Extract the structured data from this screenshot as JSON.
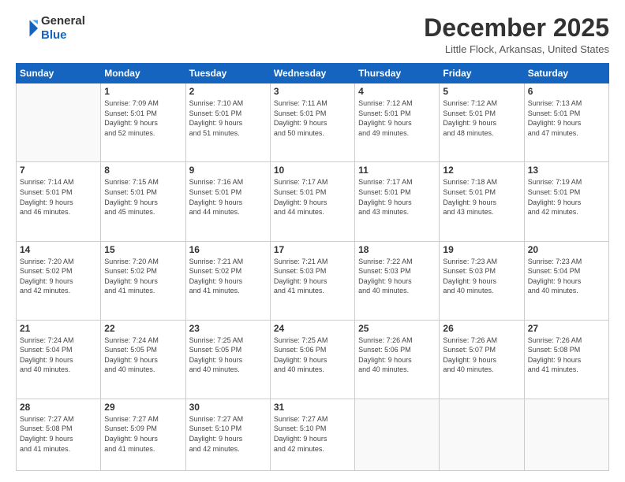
{
  "logo": {
    "line1": "General",
    "line2": "Blue"
  },
  "title": "December 2025",
  "location": "Little Flock, Arkansas, United States",
  "days_of_week": [
    "Sunday",
    "Monday",
    "Tuesday",
    "Wednesday",
    "Thursday",
    "Friday",
    "Saturday"
  ],
  "weeks": [
    [
      {
        "day": "",
        "info": ""
      },
      {
        "day": "1",
        "info": "Sunrise: 7:09 AM\nSunset: 5:01 PM\nDaylight: 9 hours\nand 52 minutes."
      },
      {
        "day": "2",
        "info": "Sunrise: 7:10 AM\nSunset: 5:01 PM\nDaylight: 9 hours\nand 51 minutes."
      },
      {
        "day": "3",
        "info": "Sunrise: 7:11 AM\nSunset: 5:01 PM\nDaylight: 9 hours\nand 50 minutes."
      },
      {
        "day": "4",
        "info": "Sunrise: 7:12 AM\nSunset: 5:01 PM\nDaylight: 9 hours\nand 49 minutes."
      },
      {
        "day": "5",
        "info": "Sunrise: 7:12 AM\nSunset: 5:01 PM\nDaylight: 9 hours\nand 48 minutes."
      },
      {
        "day": "6",
        "info": "Sunrise: 7:13 AM\nSunset: 5:01 PM\nDaylight: 9 hours\nand 47 minutes."
      }
    ],
    [
      {
        "day": "7",
        "info": "Sunrise: 7:14 AM\nSunset: 5:01 PM\nDaylight: 9 hours\nand 46 minutes."
      },
      {
        "day": "8",
        "info": "Sunrise: 7:15 AM\nSunset: 5:01 PM\nDaylight: 9 hours\nand 45 minutes."
      },
      {
        "day": "9",
        "info": "Sunrise: 7:16 AM\nSunset: 5:01 PM\nDaylight: 9 hours\nand 44 minutes."
      },
      {
        "day": "10",
        "info": "Sunrise: 7:17 AM\nSunset: 5:01 PM\nDaylight: 9 hours\nand 44 minutes."
      },
      {
        "day": "11",
        "info": "Sunrise: 7:17 AM\nSunset: 5:01 PM\nDaylight: 9 hours\nand 43 minutes."
      },
      {
        "day": "12",
        "info": "Sunrise: 7:18 AM\nSunset: 5:01 PM\nDaylight: 9 hours\nand 43 minutes."
      },
      {
        "day": "13",
        "info": "Sunrise: 7:19 AM\nSunset: 5:01 PM\nDaylight: 9 hours\nand 42 minutes."
      }
    ],
    [
      {
        "day": "14",
        "info": "Sunrise: 7:20 AM\nSunset: 5:02 PM\nDaylight: 9 hours\nand 42 minutes."
      },
      {
        "day": "15",
        "info": "Sunrise: 7:20 AM\nSunset: 5:02 PM\nDaylight: 9 hours\nand 41 minutes."
      },
      {
        "day": "16",
        "info": "Sunrise: 7:21 AM\nSunset: 5:02 PM\nDaylight: 9 hours\nand 41 minutes."
      },
      {
        "day": "17",
        "info": "Sunrise: 7:21 AM\nSunset: 5:03 PM\nDaylight: 9 hours\nand 41 minutes."
      },
      {
        "day": "18",
        "info": "Sunrise: 7:22 AM\nSunset: 5:03 PM\nDaylight: 9 hours\nand 40 minutes."
      },
      {
        "day": "19",
        "info": "Sunrise: 7:23 AM\nSunset: 5:03 PM\nDaylight: 9 hours\nand 40 minutes."
      },
      {
        "day": "20",
        "info": "Sunrise: 7:23 AM\nSunset: 5:04 PM\nDaylight: 9 hours\nand 40 minutes."
      }
    ],
    [
      {
        "day": "21",
        "info": "Sunrise: 7:24 AM\nSunset: 5:04 PM\nDaylight: 9 hours\nand 40 minutes."
      },
      {
        "day": "22",
        "info": "Sunrise: 7:24 AM\nSunset: 5:05 PM\nDaylight: 9 hours\nand 40 minutes."
      },
      {
        "day": "23",
        "info": "Sunrise: 7:25 AM\nSunset: 5:05 PM\nDaylight: 9 hours\nand 40 minutes."
      },
      {
        "day": "24",
        "info": "Sunrise: 7:25 AM\nSunset: 5:06 PM\nDaylight: 9 hours\nand 40 minutes."
      },
      {
        "day": "25",
        "info": "Sunrise: 7:26 AM\nSunset: 5:06 PM\nDaylight: 9 hours\nand 40 minutes."
      },
      {
        "day": "26",
        "info": "Sunrise: 7:26 AM\nSunset: 5:07 PM\nDaylight: 9 hours\nand 40 minutes."
      },
      {
        "day": "27",
        "info": "Sunrise: 7:26 AM\nSunset: 5:08 PM\nDaylight: 9 hours\nand 41 minutes."
      }
    ],
    [
      {
        "day": "28",
        "info": "Sunrise: 7:27 AM\nSunset: 5:08 PM\nDaylight: 9 hours\nand 41 minutes."
      },
      {
        "day": "29",
        "info": "Sunrise: 7:27 AM\nSunset: 5:09 PM\nDaylight: 9 hours\nand 41 minutes."
      },
      {
        "day": "30",
        "info": "Sunrise: 7:27 AM\nSunset: 5:10 PM\nDaylight: 9 hours\nand 42 minutes."
      },
      {
        "day": "31",
        "info": "Sunrise: 7:27 AM\nSunset: 5:10 PM\nDaylight: 9 hours\nand 42 minutes."
      },
      {
        "day": "",
        "info": ""
      },
      {
        "day": "",
        "info": ""
      },
      {
        "day": "",
        "info": ""
      }
    ]
  ]
}
